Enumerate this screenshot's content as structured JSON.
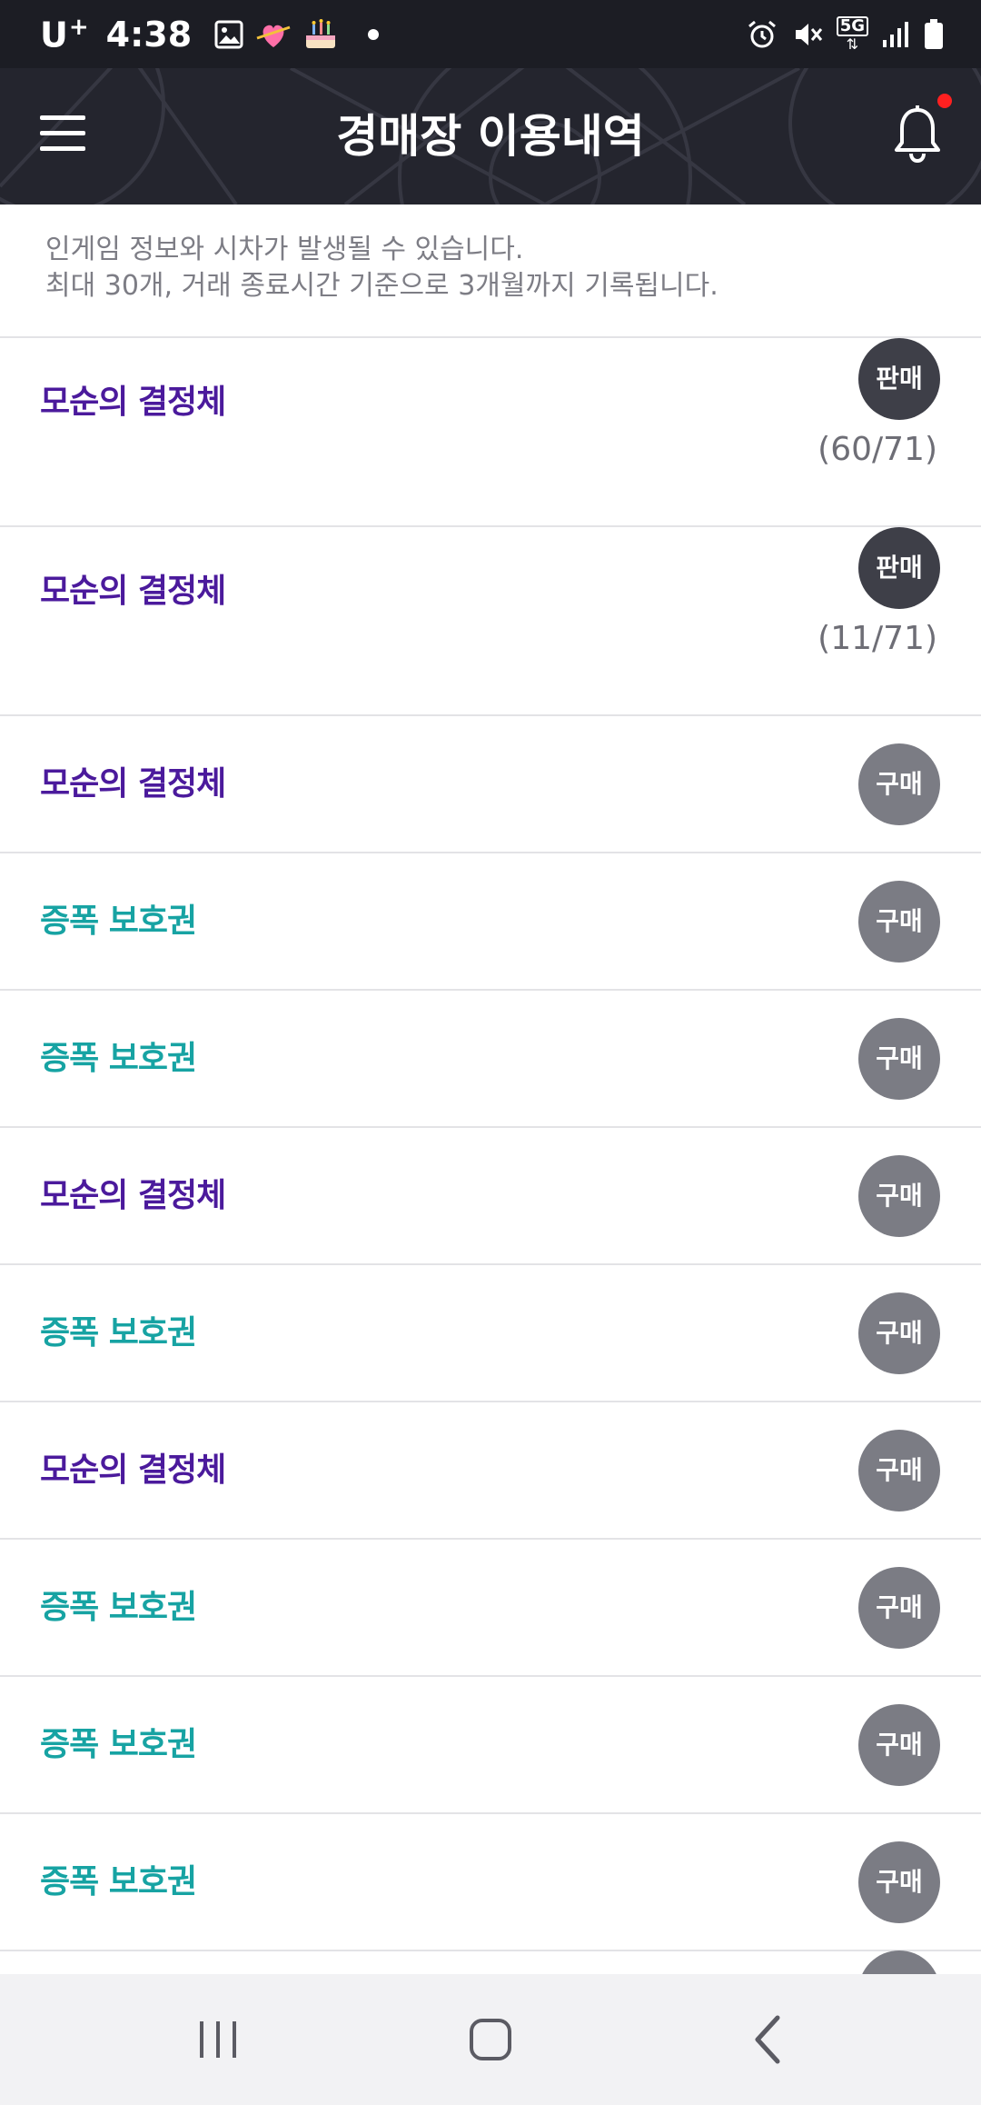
{
  "status_bar": {
    "carrier": "U",
    "carrier_sup": "+",
    "time": "4:38",
    "network": "5G"
  },
  "header": {
    "title": "경매장 이용내역"
  },
  "notice": {
    "line1": "인게임 정보와 시차가 발생될 수 있습니다.",
    "line2": "최대 30개, 거래 종료시간 기준으로 3개월까지 기록됩니다."
  },
  "colors": {
    "purple_item": "#4b1a9c",
    "teal_item": "#17a3a3"
  },
  "rows": [
    {
      "name": "모순의 결정체",
      "color": "purple",
      "badge": "판매",
      "type": "sell",
      "qty": "(60/71)"
    },
    {
      "name": "모순의 결정체",
      "color": "purple",
      "badge": "판매",
      "type": "sell",
      "qty": "(11/71)"
    },
    {
      "name": "모순의 결정체",
      "color": "purple",
      "badge": "구매",
      "type": "buy"
    },
    {
      "name": "증폭 보호권",
      "color": "teal",
      "badge": "구매",
      "type": "buy"
    },
    {
      "name": "증폭 보호권",
      "color": "teal",
      "badge": "구매",
      "type": "buy"
    },
    {
      "name": "모순의 결정체",
      "color": "purple",
      "badge": "구매",
      "type": "buy"
    },
    {
      "name": "증폭 보호권",
      "color": "teal",
      "badge": "구매",
      "type": "buy"
    },
    {
      "name": "모순의 결정체",
      "color": "purple",
      "badge": "구매",
      "type": "buy"
    },
    {
      "name": "증폭 보호권",
      "color": "teal",
      "badge": "구매",
      "type": "buy"
    },
    {
      "name": "증폭 보호권",
      "color": "teal",
      "badge": "구매",
      "type": "buy"
    },
    {
      "name": "증폭 보호권",
      "color": "teal",
      "badge": "구매",
      "type": "buy"
    }
  ]
}
